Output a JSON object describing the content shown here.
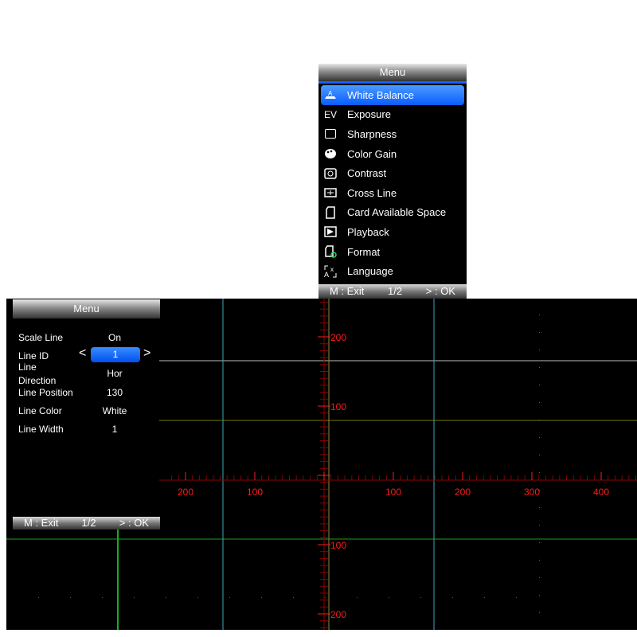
{
  "top_menu": {
    "title": "Menu",
    "items": [
      {
        "label": "White Balance",
        "icon": "white-balance-icon",
        "selected": true
      },
      {
        "label": "Exposure",
        "icon": "exposure-ev-icon"
      },
      {
        "label": "Sharpness",
        "icon": "sharpness-icon"
      },
      {
        "label": "Color Gain",
        "icon": "palette-icon"
      },
      {
        "label": "Contrast",
        "icon": "contrast-icon"
      },
      {
        "label": "Cross Line",
        "icon": "crossline-icon"
      },
      {
        "label": "Card Available Space",
        "icon": "sd-card-icon"
      },
      {
        "label": "Playback",
        "icon": "playback-icon"
      },
      {
        "label": "Format",
        "icon": "format-card-icon"
      },
      {
        "label": "Language",
        "icon": "language-icon"
      }
    ],
    "ev_glyph": "EV",
    "footer": {
      "exit": "M : Exit",
      "page": "1/2",
      "ok": "> : OK"
    }
  },
  "left_menu": {
    "title": "Menu",
    "rows": {
      "scale_line": {
        "label": "Scale Line",
        "value": "On"
      },
      "line_id": {
        "label": "Line ID",
        "value": "1",
        "prev": "<",
        "next": ">"
      },
      "line_direction": {
        "label_1": "Line",
        "label_2": "Direction",
        "value": "Hor"
      },
      "line_position": {
        "label": "Line Position",
        "value": "130"
      },
      "line_color": {
        "label": "Line Color",
        "value": "White"
      },
      "line_width": {
        "label": "Line Width",
        "value": "1"
      }
    },
    "footer": {
      "exit": "M : Exit",
      "page": "1/2",
      "ok": "> : OK"
    }
  },
  "scale": {
    "color": "#ff1a1a",
    "x_labels": [
      -200,
      -100,
      100,
      200,
      300,
      400
    ],
    "y_labels": [
      200,
      100,
      -100,
      -200
    ],
    "label_text": {
      "-200": "200",
      "-100": "100",
      "100": "100",
      "200": "200",
      "300": "300",
      "400": "400"
    }
  },
  "lines": {
    "accent": "#0a5cff"
  }
}
